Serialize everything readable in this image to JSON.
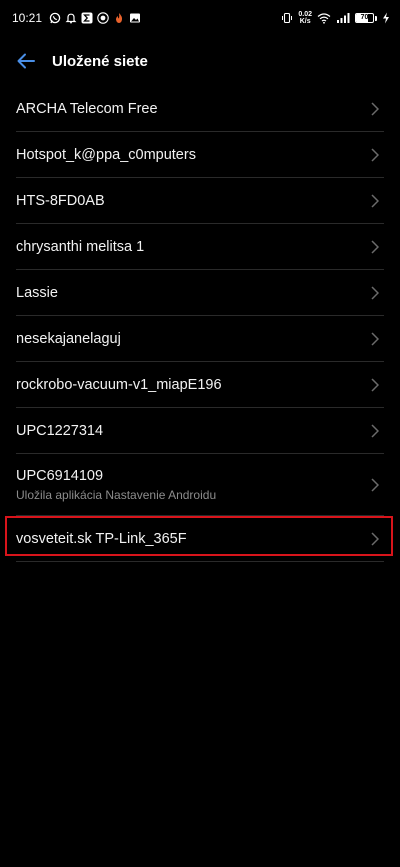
{
  "status_bar": {
    "time": "10:21",
    "net_speed_value": "0.02",
    "net_speed_unit": "K/s",
    "battery_level": "70",
    "battery_fraction": 0.7,
    "left_icons": [
      "whatsapp-icon",
      "bell-icon",
      "sigma-app-icon",
      "badge-icon",
      "fire-icon",
      "image-icon"
    ],
    "right_icons": [
      "vibrate-icon",
      "wifi-icon",
      "signal-icon",
      "charging-icon"
    ]
  },
  "header": {
    "title": "Uložené siete",
    "back_icon": "arrow-left-icon",
    "accent_color": "#4a8fe7"
  },
  "networks": [
    {
      "name": "ARCHA Telecom Free",
      "subtitle": ""
    },
    {
      "name": "Hotspot_k@ppa_c0mputers",
      "subtitle": ""
    },
    {
      "name": "HTS-8FD0AB",
      "subtitle": ""
    },
    {
      "name": "chrysanthi melitsa 1",
      "subtitle": ""
    },
    {
      "name": "Lassie",
      "subtitle": ""
    },
    {
      "name": "nesekajanelaguj",
      "subtitle": ""
    },
    {
      "name": "rockrobo-vacuum-v1_miapE196",
      "subtitle": ""
    },
    {
      "name": "UPC1227314",
      "subtitle": ""
    },
    {
      "name": "UPC6914109",
      "subtitle": "Uložila aplikácia Nastavenie Androidu"
    },
    {
      "name": "vosveteit.sk TP-Link_365F",
      "subtitle": "",
      "highlighted": true
    }
  ],
  "colors": {
    "background": "#000000",
    "divider": "#2a2a2a",
    "highlight": "#d9141b",
    "chevron": "#6b6b6b"
  }
}
